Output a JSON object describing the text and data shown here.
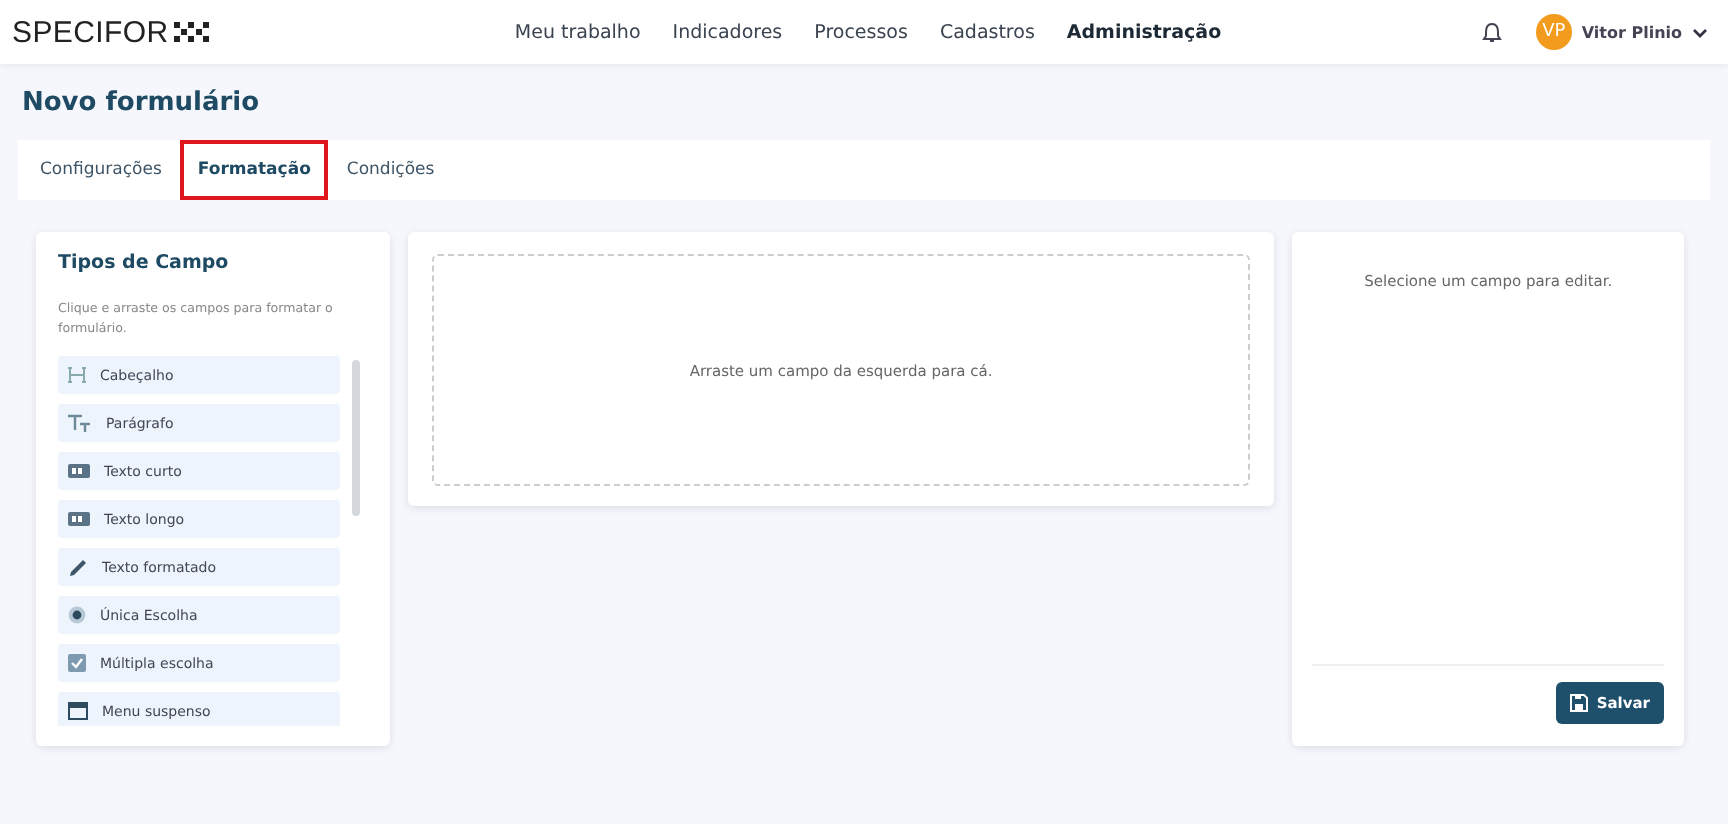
{
  "header": {
    "logo": "SPECIFOR",
    "nav": [
      {
        "label": "Meu trabalho",
        "selected": false
      },
      {
        "label": "Indicadores",
        "selected": false
      },
      {
        "label": "Processos",
        "selected": false
      },
      {
        "label": "Cadastros",
        "selected": false
      },
      {
        "label": "Administração",
        "selected": true
      }
    ],
    "user": {
      "initials": "VP",
      "name": "Vitor Plinio"
    }
  },
  "page_title": "Novo formulário",
  "tabs": [
    {
      "label": "Configurações",
      "selected": false
    },
    {
      "label": "Formatação",
      "selected": true
    },
    {
      "label": "Condições",
      "selected": false
    }
  ],
  "field_types": {
    "title": "Tipos de Campo",
    "hint": "Clique e arraste os campos para formatar o formulário.",
    "items": [
      {
        "kind": "heading",
        "label": "Cabeçalho"
      },
      {
        "kind": "paragraph",
        "label": "Parágrafo"
      },
      {
        "kind": "input",
        "label": "Texto curto"
      },
      {
        "kind": "input",
        "label": "Texto longo"
      },
      {
        "kind": "pen",
        "label": "Texto formatado"
      },
      {
        "kind": "radio",
        "label": "Única Escolha"
      },
      {
        "kind": "checkbox",
        "label": "Múltipla escolha"
      },
      {
        "kind": "menu",
        "label": "Menu suspenso"
      }
    ]
  },
  "canvas": {
    "placeholder": "Arraste um campo da esquerda para cá."
  },
  "editor": {
    "message": "Selecione um campo para editar.",
    "save_button": "Salvar"
  }
}
